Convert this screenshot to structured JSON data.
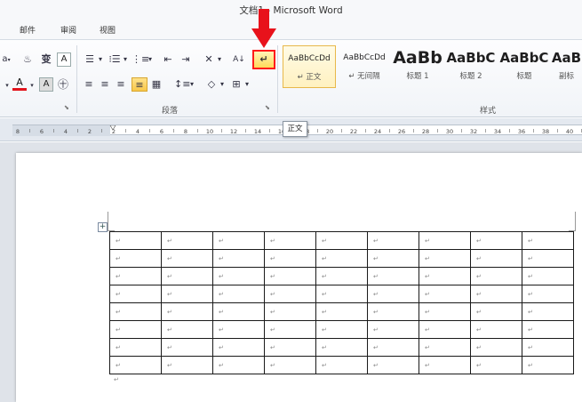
{
  "window": {
    "title": "文档1 - Microsoft Word"
  },
  "tabs": [
    "邮件",
    "审阅",
    "视图"
  ],
  "ribbon": {
    "font_group": {
      "partial_label": "a",
      "font_color_label": "A"
    },
    "paragraph_group": {
      "label": "段落",
      "sort_label": "A↓",
      "show_marks_symbol": "↵"
    },
    "styles_group": {
      "label": "样式",
      "styles": [
        {
          "sample": "AaBbCcDd",
          "name": "↵ 正文",
          "selected": true
        },
        {
          "sample": "AaBbCcDd",
          "name": "↵ 无间隔",
          "selected": false
        },
        {
          "sample": "AaBb",
          "name": "标题 1",
          "selected": false
        },
        {
          "sample": "AaBbC",
          "name": "标题 2",
          "selected": false
        },
        {
          "sample": "AaBbC",
          "name": "标题",
          "selected": false
        },
        {
          "sample": "AaB",
          "name": "副标",
          "selected": false
        }
      ]
    }
  },
  "ruler": {
    "numbers": [
      "8",
      "6",
      "4",
      "2",
      "2",
      "4",
      "6",
      "8",
      "10",
      "12",
      "14",
      "16",
      "18",
      "20",
      "22",
      "24",
      "26",
      "28",
      "30",
      "32",
      "34",
      "36",
      "38",
      "40"
    ]
  },
  "tooltip": "正文",
  "table": {
    "rows": 8,
    "cols": 9,
    "cell_mark": "↵"
  },
  "after_table_mark": "↵",
  "move_handle": "+",
  "colors": {
    "highlight_border": "#ff1a1a",
    "arrow": "#e8121b",
    "selected_style": "#fff1c0"
  }
}
